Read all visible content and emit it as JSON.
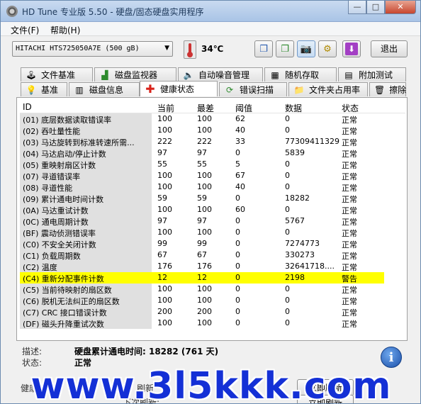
{
  "window": {
    "title": "HD Tune 专业版 5.50 - 硬盘/固态硬盘实用程序",
    "minimize": "—",
    "maximize": "□",
    "close": "✕"
  },
  "menu": [
    {
      "label": "文件(F)"
    },
    {
      "label": "帮助(H)"
    }
  ],
  "toolbar": {
    "drive": "HITACHI HTS725050A7E (500 gB)",
    "temperature": "34℃",
    "exit_label": "退出",
    "icons": [
      "copy-icon",
      "copy-info-icon",
      "camera-icon",
      "settings-icon",
      "download-icon"
    ]
  },
  "tabs_top": [
    {
      "label": "文件基准",
      "icon": "file-benchmark-icon"
    },
    {
      "label": "磁盘监视器",
      "icon": "disk-monitor-icon"
    },
    {
      "label": "自动噪音管理",
      "icon": "speaker-icon"
    },
    {
      "label": "随机存取",
      "icon": "random-access-icon"
    },
    {
      "label": "附加测试",
      "icon": "extra-tests-icon"
    }
  ],
  "tabs_bottom": [
    {
      "label": "基准",
      "icon": "benchmark-icon"
    },
    {
      "label": "磁盘信息",
      "icon": "disk-info-icon"
    },
    {
      "label": "健康状态",
      "icon": "health-cross-icon",
      "active": true
    },
    {
      "label": "错误扫描",
      "icon": "error-scan-icon"
    },
    {
      "label": "文件夹占用率",
      "icon": "folder-icon"
    },
    {
      "label": "擦除",
      "icon": "erase-icon"
    }
  ],
  "table": {
    "headers": [
      "ID",
      "当前",
      "最差",
      "阈值",
      "数据",
      "状态"
    ],
    "rows": [
      {
        "id": "(01) 底层数据读取错误率",
        "current": "100",
        "worst": "100",
        "threshold": "62",
        "data": "0",
        "status": "正常"
      },
      {
        "id": "(02) 吞吐量性能",
        "current": "100",
        "worst": "100",
        "threshold": "40",
        "data": "0",
        "status": "正常"
      },
      {
        "id": "(03) 马达旋转到标准转速所需...",
        "current": "222",
        "worst": "222",
        "threshold": "33",
        "data": "77309411329",
        "status": "正常"
      },
      {
        "id": "(04) 马达启动/停止计数",
        "current": "97",
        "worst": "97",
        "threshold": "0",
        "data": "5839",
        "status": "正常"
      },
      {
        "id": "(05) 重映射扇区计数",
        "current": "55",
        "worst": "55",
        "threshold": "5",
        "data": "0",
        "status": "正常"
      },
      {
        "id": "(07) 寻道错误率",
        "current": "100",
        "worst": "100",
        "threshold": "67",
        "data": "0",
        "status": "正常"
      },
      {
        "id": "(08) 寻道性能",
        "current": "100",
        "worst": "100",
        "threshold": "40",
        "data": "0",
        "status": "正常"
      },
      {
        "id": "(09) 累计通电时间计数",
        "current": "59",
        "worst": "59",
        "threshold": "0",
        "data": "18282",
        "status": "正常"
      },
      {
        "id": "(0A) 马达重试计数",
        "current": "100",
        "worst": "100",
        "threshold": "60",
        "data": "0",
        "status": "正常"
      },
      {
        "id": "(0C) 通电周期计数",
        "current": "97",
        "worst": "97",
        "threshold": "0",
        "data": "5767",
        "status": "正常"
      },
      {
        "id": "(BF) 震动侦测错误率",
        "current": "100",
        "worst": "100",
        "threshold": "0",
        "data": "0",
        "status": "正常"
      },
      {
        "id": "(C0) 不安全关闭计数",
        "current": "99",
        "worst": "99",
        "threshold": "0",
        "data": "7274773",
        "status": "正常"
      },
      {
        "id": "(C1) 负载周期数",
        "current": "67",
        "worst": "67",
        "threshold": "0",
        "data": "330273",
        "status": "正常"
      },
      {
        "id": "(C2) 温度",
        "current": "176",
        "worst": "176",
        "threshold": "0",
        "data": "32641718....",
        "status": "正常"
      },
      {
        "id": "(C4) 重新分配事件计数",
        "current": "12",
        "worst": "12",
        "threshold": "0",
        "data": "2198",
        "status": "警告",
        "warn": true
      },
      {
        "id": "(C5) 当前待映射的扇区数",
        "current": "100",
        "worst": "100",
        "threshold": "0",
        "data": "0",
        "status": "正常"
      },
      {
        "id": "(C6) 脱机无法纠正的扇区数",
        "current": "100",
        "worst": "100",
        "threshold": "0",
        "data": "0",
        "status": "正常"
      },
      {
        "id": "(C7) CRC 接口错误计数",
        "current": "200",
        "worst": "200",
        "threshold": "0",
        "data": "0",
        "status": "正常"
      },
      {
        "id": "(DF) 磁头升降重试次数",
        "current": "100",
        "worst": "100",
        "threshold": "0",
        "data": "0",
        "status": "正常"
      }
    ]
  },
  "description": {
    "desc_label": "描述:",
    "desc_value": "硬盘累计通电时间: 18282 (761 天)",
    "status_label": "状态:",
    "status_value": "正常",
    "info_glyph": "i"
  },
  "bottom": {
    "health_label": "健康状态:",
    "refresh_label": "刷新",
    "next_refresh_label": "下次刷新:",
    "refresh_now_label": "立即刷新",
    "refresh_now_label2": "立即刷新"
  },
  "watermark": "www.3l5kkk.com",
  "colors": {
    "warning_row": "#ffff00",
    "active_tab_icon": "#d8231b",
    "watermark": "#1430d6"
  }
}
